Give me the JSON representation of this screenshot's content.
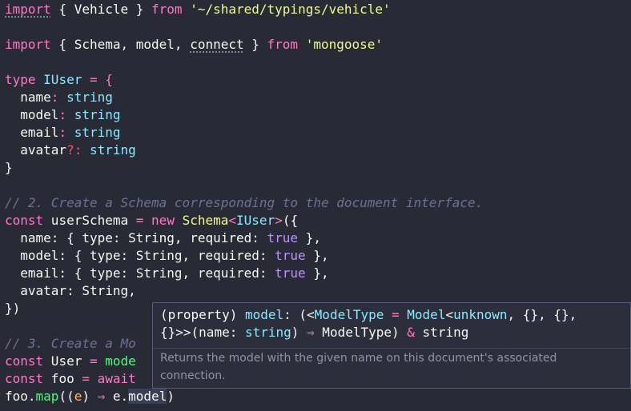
{
  "editor": {
    "lines": {
      "l1": {
        "kw": "import",
        "mid": " { Vehicle } ",
        "from": "from",
        "str": "'~/shared/typings/vehicle'"
      },
      "l3": {
        "kw": "import",
        "a": " { Schema, model, ",
        "connect": "connect",
        "b": " } ",
        "from": "from",
        "str": "'mongoose'"
      },
      "l5": {
        "kw": "type",
        "name": "IUser",
        "eq": " = {"
      },
      "l6": {
        "prop": "  name",
        "colon": ": ",
        "type": "string"
      },
      "l7": {
        "prop": "  model",
        "colon": ": ",
        "type": "string"
      },
      "l8": {
        "prop": "  email",
        "colon": ": ",
        "type": "string"
      },
      "l9": {
        "prop": "  avatar",
        "opt": "?:",
        "sp": " ",
        "type": "string"
      },
      "l10": {
        "text": "}"
      },
      "l12": {
        "comment": "// 2. Create a Schema corresponding to the document interface."
      },
      "l13": {
        "kw": "const",
        "a": " userSchema ",
        "eq": "=",
        "sp": " ",
        "new": "new",
        "sp2": " ",
        "cls": "Schema",
        "lt": "<",
        "gen": "IUser",
        "gt": ">",
        "rest": "({"
      },
      "l14": {
        "a": "  name: { type: String, required: ",
        "bool": "true",
        "b": " },"
      },
      "l15": {
        "a": "  model: { type: String, required: ",
        "bool": "true",
        "b": " },"
      },
      "l16": {
        "a": "  email: { type: String, required: ",
        "bool": "true",
        "b": " },"
      },
      "l17": {
        "text": "  avatar: String,"
      },
      "l18": {
        "text": "})"
      },
      "l20": {
        "comment": "// 3. Create a Mo"
      },
      "l21": {
        "kw": "const",
        "a": " User ",
        "eq": "=",
        "sp": " ",
        "fn": "mode"
      },
      "l22": {
        "kw": "const",
        "a": " foo ",
        "eq": "=",
        "sp": " ",
        "await": "await"
      },
      "l23": {
        "a": "foo.",
        "fn": "map",
        "b": "((",
        "param": "e",
        "c": ") ",
        "arrow": "⇒",
        "d": " e.",
        "sel": "model",
        "e": ")"
      }
    }
  },
  "hover": {
    "sig": {
      "a": "(property) ",
      "name": "model",
      "b": ": (<",
      "mt": "ModelType",
      "c": " = ",
      "model": "Model",
      "d": "<",
      "unknown": "unknown",
      "e": ", {}, {},",
      "f": "{}>>(",
      "pname": "name",
      "g": ": ",
      "ptype": "string",
      "h": ") ",
      "arrow": "⇒",
      "i": " ModelType) ",
      "amp": "&",
      "j": " ",
      "ret": "string"
    },
    "doc": "Returns the model with the given name on this document's associated connection."
  }
}
